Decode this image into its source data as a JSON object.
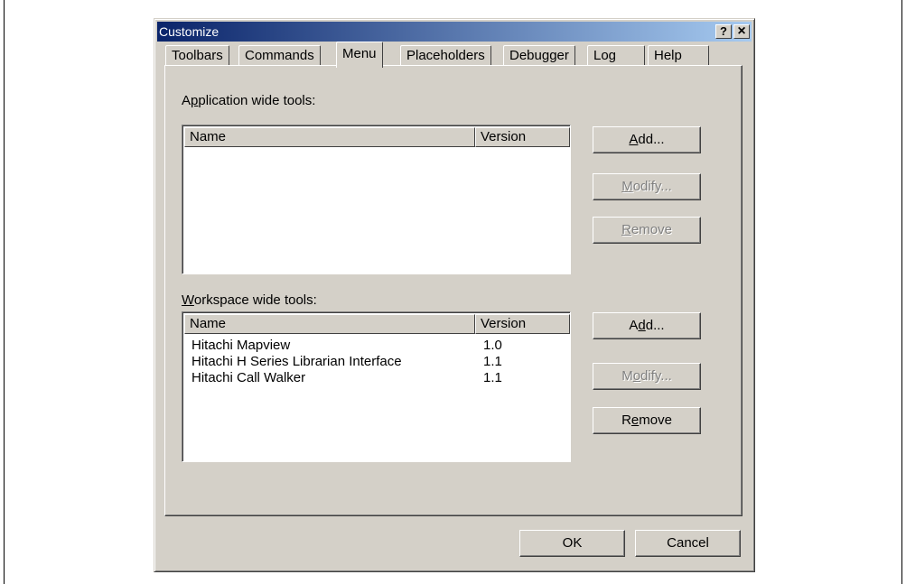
{
  "window": {
    "title": "Customize",
    "help_glyph": "?",
    "close_glyph": "×"
  },
  "tabs": [
    {
      "label": "Toolbars",
      "active": false
    },
    {
      "label": "Commands",
      "active": false
    },
    {
      "label": "Menu",
      "active": true
    },
    {
      "label": "Placeholders",
      "active": false
    },
    {
      "label": "Debugger",
      "active": false
    },
    {
      "label": "Log",
      "active": false
    },
    {
      "label": "Help",
      "active": false
    }
  ],
  "application_tools": {
    "label_pre": "A",
    "label_ul": "p",
    "label_post": "plication wide tools:",
    "columns": [
      "Name",
      "Version"
    ],
    "rows": [],
    "add": {
      "pre": "",
      "ul": "A",
      "post": "dd..."
    },
    "modify": {
      "pre": "",
      "ul": "M",
      "post": "odify..."
    },
    "remove": {
      "pre": "",
      "ul": "R",
      "post": "emove"
    }
  },
  "workspace_tools": {
    "label_pre": "",
    "label_ul": "W",
    "label_post": "orkspace wide tools:",
    "columns": [
      "Name",
      "Version"
    ],
    "rows": [
      {
        "name": "Hitachi Mapview",
        "version": "1.0"
      },
      {
        "name": "Hitachi H Series Librarian Interface",
        "version": "1.1"
      },
      {
        "name": "Hitachi Call Walker",
        "version": "1.1"
      }
    ],
    "add": {
      "pre": "A",
      "ul": "d",
      "post": "d..."
    },
    "modify": {
      "pre": "M",
      "ul": "o",
      "post": "dify..."
    },
    "remove": {
      "pre": "R",
      "ul": "e",
      "post": "move"
    }
  },
  "footer": {
    "ok": "OK",
    "cancel": "Cancel"
  }
}
